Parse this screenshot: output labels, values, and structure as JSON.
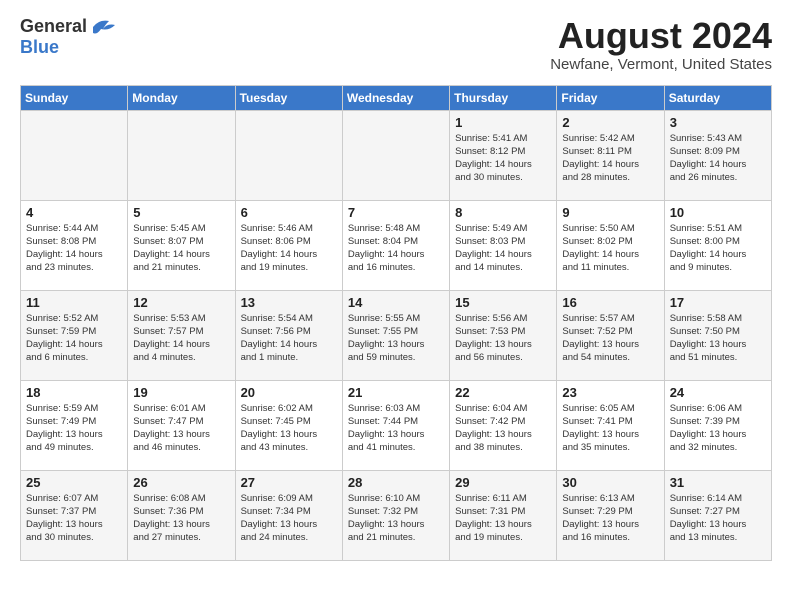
{
  "logo": {
    "general": "General",
    "blue": "Blue"
  },
  "title": {
    "month_year": "August 2024",
    "location": "Newfane, Vermont, United States"
  },
  "headers": [
    "Sunday",
    "Monday",
    "Tuesday",
    "Wednesday",
    "Thursday",
    "Friday",
    "Saturday"
  ],
  "weeks": [
    [
      {
        "day": "",
        "info": ""
      },
      {
        "day": "",
        "info": ""
      },
      {
        "day": "",
        "info": ""
      },
      {
        "day": "",
        "info": ""
      },
      {
        "day": "1",
        "info": "Sunrise: 5:41 AM\nSunset: 8:12 PM\nDaylight: 14 hours\nand 30 minutes."
      },
      {
        "day": "2",
        "info": "Sunrise: 5:42 AM\nSunset: 8:11 PM\nDaylight: 14 hours\nand 28 minutes."
      },
      {
        "day": "3",
        "info": "Sunrise: 5:43 AM\nSunset: 8:09 PM\nDaylight: 14 hours\nand 26 minutes."
      }
    ],
    [
      {
        "day": "4",
        "info": "Sunrise: 5:44 AM\nSunset: 8:08 PM\nDaylight: 14 hours\nand 23 minutes."
      },
      {
        "day": "5",
        "info": "Sunrise: 5:45 AM\nSunset: 8:07 PM\nDaylight: 14 hours\nand 21 minutes."
      },
      {
        "day": "6",
        "info": "Sunrise: 5:46 AM\nSunset: 8:06 PM\nDaylight: 14 hours\nand 19 minutes."
      },
      {
        "day": "7",
        "info": "Sunrise: 5:48 AM\nSunset: 8:04 PM\nDaylight: 14 hours\nand 16 minutes."
      },
      {
        "day": "8",
        "info": "Sunrise: 5:49 AM\nSunset: 8:03 PM\nDaylight: 14 hours\nand 14 minutes."
      },
      {
        "day": "9",
        "info": "Sunrise: 5:50 AM\nSunset: 8:02 PM\nDaylight: 14 hours\nand 11 minutes."
      },
      {
        "day": "10",
        "info": "Sunrise: 5:51 AM\nSunset: 8:00 PM\nDaylight: 14 hours\nand 9 minutes."
      }
    ],
    [
      {
        "day": "11",
        "info": "Sunrise: 5:52 AM\nSunset: 7:59 PM\nDaylight: 14 hours\nand 6 minutes."
      },
      {
        "day": "12",
        "info": "Sunrise: 5:53 AM\nSunset: 7:57 PM\nDaylight: 14 hours\nand 4 minutes."
      },
      {
        "day": "13",
        "info": "Sunrise: 5:54 AM\nSunset: 7:56 PM\nDaylight: 14 hours\nand 1 minute."
      },
      {
        "day": "14",
        "info": "Sunrise: 5:55 AM\nSunset: 7:55 PM\nDaylight: 13 hours\nand 59 minutes."
      },
      {
        "day": "15",
        "info": "Sunrise: 5:56 AM\nSunset: 7:53 PM\nDaylight: 13 hours\nand 56 minutes."
      },
      {
        "day": "16",
        "info": "Sunrise: 5:57 AM\nSunset: 7:52 PM\nDaylight: 13 hours\nand 54 minutes."
      },
      {
        "day": "17",
        "info": "Sunrise: 5:58 AM\nSunset: 7:50 PM\nDaylight: 13 hours\nand 51 minutes."
      }
    ],
    [
      {
        "day": "18",
        "info": "Sunrise: 5:59 AM\nSunset: 7:49 PM\nDaylight: 13 hours\nand 49 minutes."
      },
      {
        "day": "19",
        "info": "Sunrise: 6:01 AM\nSunset: 7:47 PM\nDaylight: 13 hours\nand 46 minutes."
      },
      {
        "day": "20",
        "info": "Sunrise: 6:02 AM\nSunset: 7:45 PM\nDaylight: 13 hours\nand 43 minutes."
      },
      {
        "day": "21",
        "info": "Sunrise: 6:03 AM\nSunset: 7:44 PM\nDaylight: 13 hours\nand 41 minutes."
      },
      {
        "day": "22",
        "info": "Sunrise: 6:04 AM\nSunset: 7:42 PM\nDaylight: 13 hours\nand 38 minutes."
      },
      {
        "day": "23",
        "info": "Sunrise: 6:05 AM\nSunset: 7:41 PM\nDaylight: 13 hours\nand 35 minutes."
      },
      {
        "day": "24",
        "info": "Sunrise: 6:06 AM\nSunset: 7:39 PM\nDaylight: 13 hours\nand 32 minutes."
      }
    ],
    [
      {
        "day": "25",
        "info": "Sunrise: 6:07 AM\nSunset: 7:37 PM\nDaylight: 13 hours\nand 30 minutes."
      },
      {
        "day": "26",
        "info": "Sunrise: 6:08 AM\nSunset: 7:36 PM\nDaylight: 13 hours\nand 27 minutes."
      },
      {
        "day": "27",
        "info": "Sunrise: 6:09 AM\nSunset: 7:34 PM\nDaylight: 13 hours\nand 24 minutes."
      },
      {
        "day": "28",
        "info": "Sunrise: 6:10 AM\nSunset: 7:32 PM\nDaylight: 13 hours\nand 21 minutes."
      },
      {
        "day": "29",
        "info": "Sunrise: 6:11 AM\nSunset: 7:31 PM\nDaylight: 13 hours\nand 19 minutes."
      },
      {
        "day": "30",
        "info": "Sunrise: 6:13 AM\nSunset: 7:29 PM\nDaylight: 13 hours\nand 16 minutes."
      },
      {
        "day": "31",
        "info": "Sunrise: 6:14 AM\nSunset: 7:27 PM\nDaylight: 13 hours\nand 13 minutes."
      }
    ]
  ]
}
